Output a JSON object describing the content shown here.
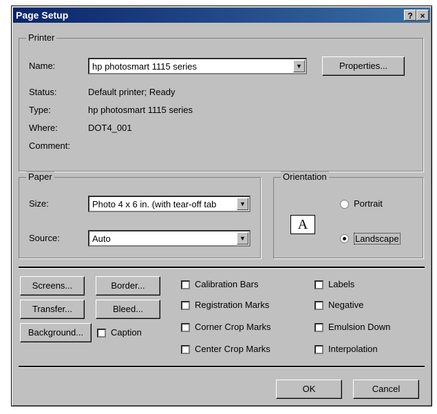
{
  "window": {
    "title": "Page Setup",
    "help_label": "?",
    "close_label": "×"
  },
  "printer": {
    "group_label": "Printer",
    "name_label": "Name:",
    "name_value": "hp photosmart 1115 series",
    "properties_label": "Properties...",
    "status_label": "Status:",
    "status_value": "Default printer; Ready",
    "type_label": "Type:",
    "type_value": "hp photosmart 1115 series",
    "where_label": "Where:",
    "where_value": "DOT4_001",
    "comment_label": "Comment:",
    "comment_value": ""
  },
  "paper": {
    "group_label": "Paper",
    "size_label": "Size:",
    "size_value": "Photo 4 x 6 in. (with tear-off tab",
    "source_label": "Source:",
    "source_value": "Auto"
  },
  "orientation": {
    "group_label": "Orientation",
    "preview_glyph": "A",
    "portrait_label": "Portrait",
    "landscape_label": "Landscape",
    "selected": "Landscape"
  },
  "buttons": {
    "screens": "Screens...",
    "border": "Border...",
    "transfer": "Transfer...",
    "bleed": "Bleed...",
    "background": "Background...",
    "ok": "OK",
    "cancel": "Cancel"
  },
  "checkboxes": {
    "caption": "Caption",
    "calibration_bars": "Calibration Bars",
    "registration_marks": "Registration Marks",
    "corner_crop_marks": "Corner Crop Marks",
    "center_crop_marks": "Center Crop Marks",
    "labels": "Labels",
    "negative": "Negative",
    "emulsion_down": "Emulsion Down",
    "interpolation": "Interpolation"
  }
}
